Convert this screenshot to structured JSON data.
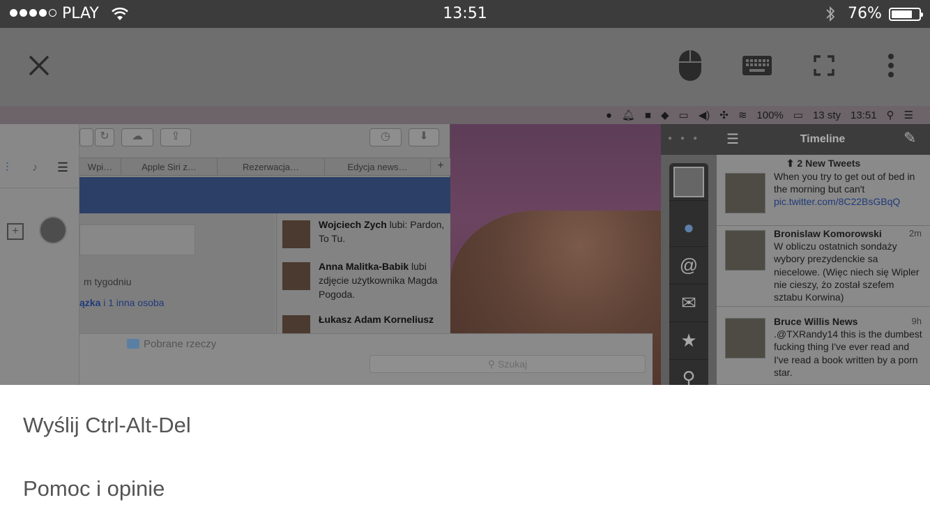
{
  "status_bar": {
    "carrier": "PLAY",
    "time": "13:51",
    "bluetooth": "bluetooth-icon",
    "battery_percent": "76%",
    "battery_level": 0.76,
    "signal_bars": 4
  },
  "toolbar": {
    "close_icon": "close-icon",
    "mouse_icon": "mouse-icon",
    "keyboard_icon": "keyboard-icon",
    "fullscreen_icon": "fullscreen-icon",
    "more_icon": "more-vertical-icon"
  },
  "remote": {
    "menubar": {
      "battery": "100%",
      "date": "13 sty",
      "time": "13:51"
    },
    "browser": {
      "tabs": [
        "Wpi…",
        "Apple Siri z…",
        "Rezerwacja…",
        "Edycja news…"
      ],
      "fb_left_text_1": "m tygodniu",
      "fb_left_text_2_a": "ązka",
      "fb_left_text_2_b": " i 1 inna osoba",
      "feed": [
        {
          "name": "Wojciech Zych",
          "text": " lubi: Pardon, To Tu."
        },
        {
          "name": "Anna Malitka-Babik",
          "text": " lubi zdjęcie użytkownika Magda Pogoda."
        },
        {
          "name": "Łukasz Adam Korneliusz",
          "text": ""
        }
      ]
    },
    "finder": {
      "title": "Pobrane rzeczy",
      "search_placeholder": "Szukaj"
    },
    "tweetbot": {
      "title": "Timeline",
      "new_tweets": "2 New Tweets",
      "tweets": [
        {
          "name": "",
          "time": "",
          "text": "When you try to get out of bed in the morning but can't",
          "link": "pic.twitter.com/8C22BsGBqQ"
        },
        {
          "name": "Bronislaw Komorowski",
          "time": "2m",
          "text": "W obliczu ostatnich sondaży wybory prezydenckie sa niecelowe. (Więc niech się Wipler nie cieszy, żo został szefem sztabu Korwina)",
          "link": ""
        },
        {
          "name": "Bruce Willis News",
          "time": "9h",
          "text": ".@TXRandy14 this is the dumbest fucking thing I've ever read and I've read a book written by a porn star.",
          "link": ""
        }
      ]
    }
  },
  "menu": {
    "items": [
      "Wyślij Ctrl-Alt-Del",
      "Pomoc i opinie"
    ]
  }
}
